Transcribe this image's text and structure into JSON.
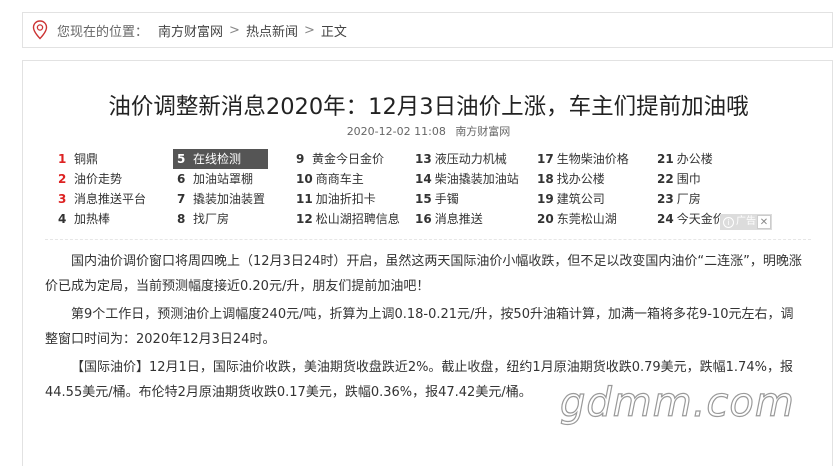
{
  "breadcrumb": {
    "prefix": "您现在的位置：",
    "items": [
      "南方财富网",
      "热点新闻",
      "正文"
    ],
    "separator": ">"
  },
  "article": {
    "title": "油价调整新消息2020年：12月3日油价上涨，车主们提前加油哦",
    "date": "2020-12-02 11:08",
    "source": "南方财富网",
    "paragraphs": [
      "国内油价调价窗口将周四晚上（12月3日24时）开启，虽然这两天国际油价小幅收跌，但不足以改变国内油价“二连涨”，明晚涨价已成为定局，当前预测幅度接近0.20元/升，朋友们提前加油吧！",
      "第9个工作日，预测油价上调幅度240元/吨，折算为上调0.18-0.21元/升，按50升油箱计算，加满一箱将多花9-10元左右，调整窗口时间为：2020年12月3日24时。",
      "【国际油价】12月1日，国际油价收跌，美油期货收盘跌近2%。截止收盘，纽约1月原油期货收跌0.79美元，跌幅1.74%，报44.55美元/桶。布伦特2月原油期货收跌0.17美元，跌幅0.36%，报47.42美元/桶。"
    ]
  },
  "hotlist": [
    {
      "num": "1",
      "label": "铜鼎"
    },
    {
      "num": "2",
      "label": "油价走势"
    },
    {
      "num": "3",
      "label": "消息推送平台"
    },
    {
      "num": "4",
      "label": "加热棒"
    },
    {
      "num": "5",
      "label": "在线检测"
    },
    {
      "num": "6",
      "label": "加油站罩棚"
    },
    {
      "num": "7",
      "label": "撬装加油装置"
    },
    {
      "num": "8",
      "label": "找厂房"
    },
    {
      "num": "9",
      "label": "黄金今日金价"
    },
    {
      "num": "10",
      "label": "商商车主"
    },
    {
      "num": "11",
      "label": "加油折扣卡"
    },
    {
      "num": "12",
      "label": "松山湖招聘信息"
    },
    {
      "num": "13",
      "label": "液压动力机械"
    },
    {
      "num": "14",
      "label": "柴油撬装加油站"
    },
    {
      "num": "15",
      "label": "手镯"
    },
    {
      "num": "16",
      "label": "消息推送"
    },
    {
      "num": "17",
      "label": "生物柴油价格"
    },
    {
      "num": "18",
      "label": "找办公楼"
    },
    {
      "num": "19",
      "label": "建筑公司"
    },
    {
      "num": "20",
      "label": "东莞松山湖"
    },
    {
      "num": "21",
      "label": "办公楼"
    },
    {
      "num": "22",
      "label": "围巾"
    },
    {
      "num": "23",
      "label": "厂房"
    },
    {
      "num": "24",
      "label": "今天金价"
    }
  ],
  "ad": {
    "label": "广告",
    "close": "✕",
    "info": "i"
  },
  "watermark": "gdmm.com",
  "colors": {
    "accent_red": "#d22222",
    "active_bg": "#555555"
  }
}
